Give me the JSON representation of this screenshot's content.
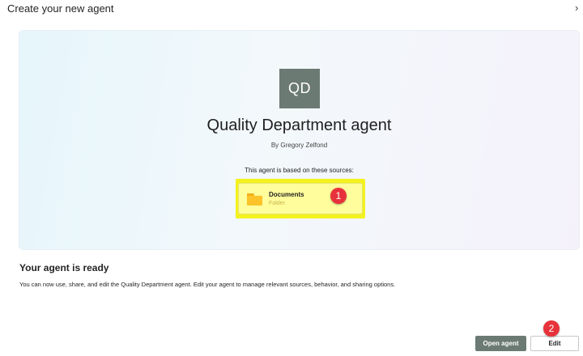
{
  "dialog": {
    "title": "Create your new agent",
    "close_glyph": "›"
  },
  "agent": {
    "initials": "QD",
    "avatar_color": "#6c7a74",
    "name": "Quality Department agent",
    "author": "By Gregory Zelfond",
    "sources_label": "This agent is based on these sources:",
    "sources": [
      {
        "name": "Documents",
        "type": "Folder",
        "icon": "folder-icon"
      }
    ]
  },
  "annotations": {
    "badge_1": "1",
    "badge_2": "2",
    "badge_color": "#e8323b",
    "highlight_color": "#f3f21e"
  },
  "ready": {
    "title": "Your agent is ready",
    "description": "You can now use, share, and edit the Quality Department agent. Edit your agent to manage relevant sources, behavior, and sharing options."
  },
  "actions": {
    "open_label": "Open agent",
    "edit_label": "Edit"
  }
}
